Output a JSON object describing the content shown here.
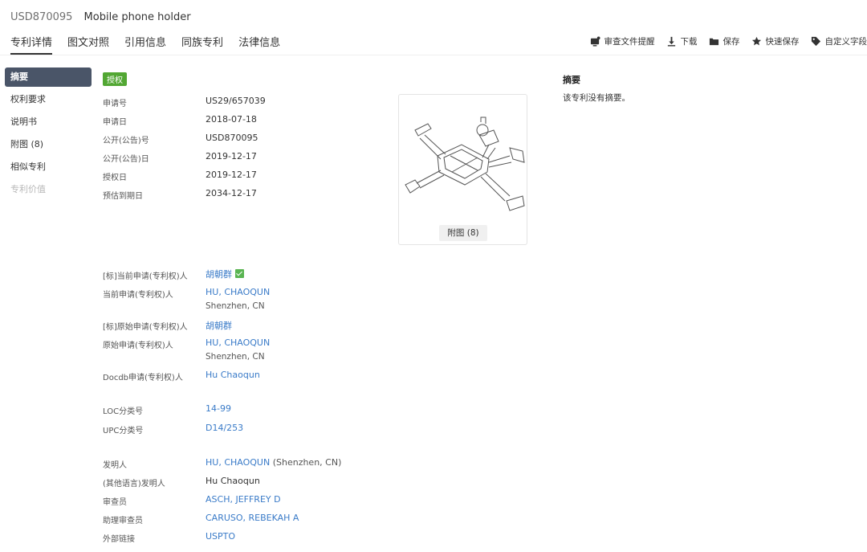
{
  "header": {
    "patent_number": "USD870095",
    "patent_title": "Mobile phone holder"
  },
  "tabs": [
    "专利详情",
    "图文对照",
    "引用信息",
    "同族专利",
    "法律信息"
  ],
  "toolbar": {
    "review_reminder": "审查文件提醒",
    "download": "下载",
    "save": "保存",
    "quick_save": "快速保存",
    "custom_fields": "自定义字段"
  },
  "sidebar": {
    "items": [
      "摘要",
      "权利要求",
      "说明书",
      "附图 (8)",
      "相似专利",
      "专利价值"
    ]
  },
  "status_badge": "授权",
  "basic_info": [
    {
      "label": "申请号",
      "value": "US29/657039"
    },
    {
      "label": "申请日",
      "value": "2018-07-18"
    },
    {
      "label": "公开(公告)号",
      "value": "USD870095"
    },
    {
      "label": "公开(公告)日",
      "value": "2019-12-17"
    },
    {
      "label": "授权日",
      "value": "2019-12-17"
    },
    {
      "label": "预估到期日",
      "value": "2034-12-17"
    }
  ],
  "figure": {
    "button_label": "附图 (8)"
  },
  "applicants": {
    "std_current_label": "[标]当前申请(专利权)人",
    "std_current_value": "胡朝群",
    "current_label": "当前申请(专利权)人",
    "current_value": "HU, CHAOQUN",
    "current_location": "Shenzhen, CN",
    "std_original_label": "[标]原始申请(专利权)人",
    "std_original_value": "胡朝群",
    "original_label": "原始申请(专利权)人",
    "original_value": "HU, CHAOQUN",
    "original_location": "Shenzhen, CN",
    "docdb_label": "Docdb申请(专利权)人",
    "docdb_value": "Hu Chaoqun"
  },
  "classification": {
    "loc_label": "LOC分类号",
    "loc_value": "14-99",
    "upc_label": "UPC分类号",
    "upc_value": "D14/253"
  },
  "people": {
    "inventor_label": "发明人",
    "inventor_value": "HU, CHAOQUN",
    "inventor_location": "(Shenzhen, CN)",
    "inventor_other_label": "(其他语言)发明人",
    "inventor_other_value": "Hu Chaoqun",
    "examiner_label": "审查员",
    "examiner_value": "ASCH, JEFFREY D",
    "assistant_examiner_label": "助理审查员",
    "assistant_examiner_value": "CARUSO, REBEKAH A",
    "external_link_label": "外部链接",
    "external_link_value": "USPTO"
  },
  "abstract": {
    "heading": "摘要",
    "text": "该专利没有摘要。"
  },
  "colors": {
    "badge_green": "#52a733",
    "link_blue": "#3a7bc8",
    "sidebar_active": "#4a5568"
  }
}
